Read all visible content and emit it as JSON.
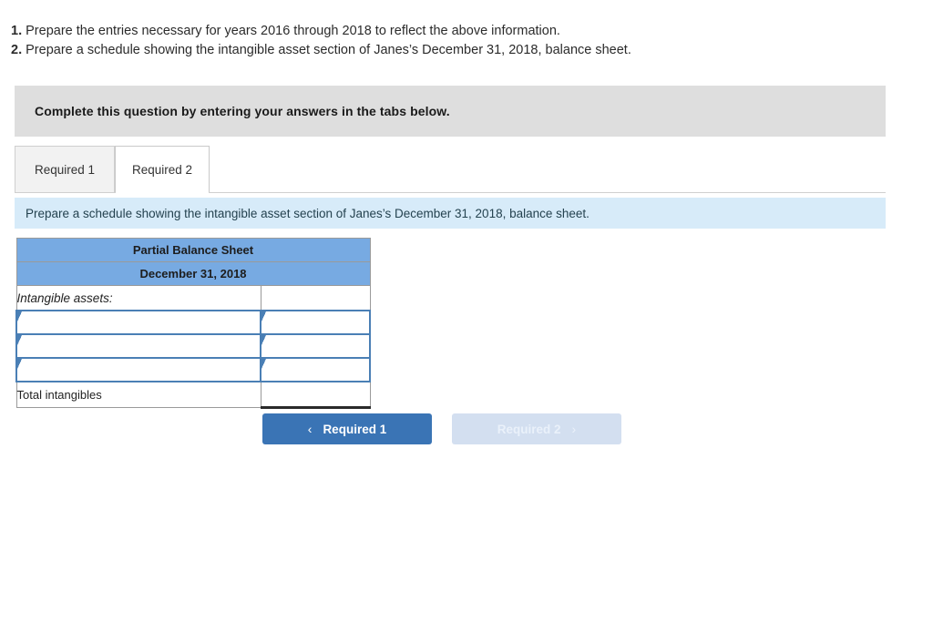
{
  "questions": [
    {
      "num": "1.",
      "text": "Prepare the entries necessary for years 2016 through 2018 to reflect the above information."
    },
    {
      "num": "2.",
      "text": "Prepare a schedule showing the intangible asset section of Janes’s December 31, 2018, balance sheet."
    }
  ],
  "complete_banner": {
    "text": "Complete this question by entering your answers in the tabs below."
  },
  "tabs": [
    {
      "label": "Required 1",
      "active": false
    },
    {
      "label": "Required 2",
      "active": true
    }
  ],
  "requirement_banner": {
    "text": "Prepare a schedule showing the intangible asset section of Janes’s December 31, 2018, balance sheet."
  },
  "balance_sheet": {
    "title": "Partial Balance Sheet",
    "date": "December 31, 2018",
    "section_label": "Intangible assets:",
    "section_value": "",
    "input_rows": [
      {
        "label": "",
        "value": ""
      },
      {
        "label": "",
        "value": ""
      },
      {
        "label": "",
        "value": ""
      }
    ],
    "total_label": "Total intangibles",
    "total_value": ""
  },
  "nav": {
    "prev": {
      "label": "Required 1",
      "icon": "chevron-left",
      "glyph": "‹"
    },
    "next": {
      "label": "Required 2",
      "icon": "chevron-right",
      "glyph": "›"
    }
  },
  "colors": {
    "header_blue": "#77aae2",
    "banner_gray": "#dedede",
    "banner_blue": "#d7ebf9",
    "button_blue": "#3a74b5",
    "button_disabled": "#d3dff0",
    "input_border_blue": "#4a7fb5"
  }
}
